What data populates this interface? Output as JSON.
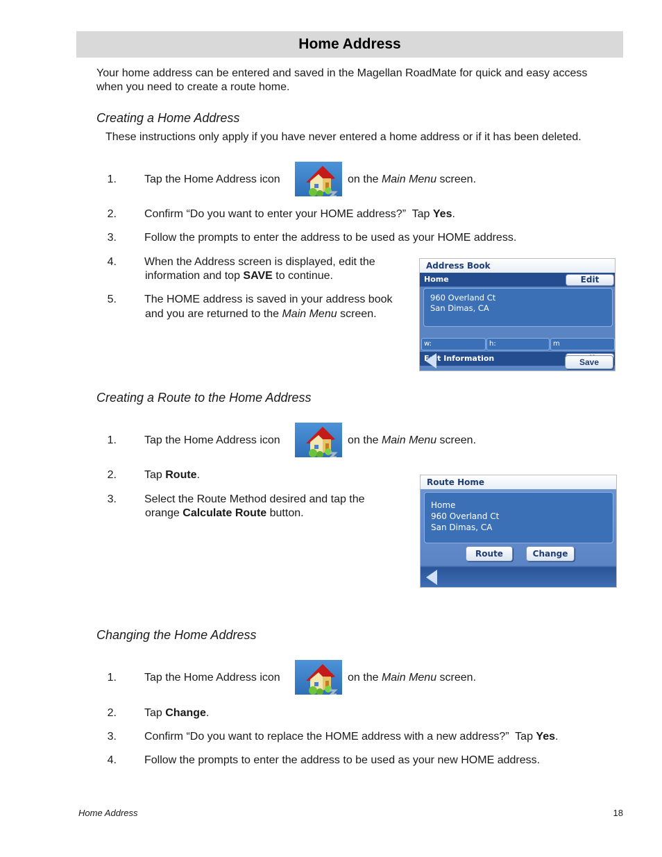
{
  "page": {
    "title": "Home Address",
    "intro": [
      "Your home address can be entered and saved in the Magellan RoadMate for quick and easy access",
      "when you need to create a route home."
    ],
    "footer": {
      "section": "Home Address",
      "page_number": "18"
    }
  },
  "sections": [
    {
      "heading": "Creating a Home Address",
      "note": "These instructions only apply if you have never entered a home address or if it has been deleted.",
      "steps": [
        {
          "num": "1.",
          "pre": "Tap the Home Address icon",
          "post_a": "on the ",
          "post_em": "Main Menu",
          "post_b": " screen.",
          "icon": "home-address-icon"
        },
        {
          "num": "2.",
          "pre": "Confirm “Do you want to enter your HOME address?”  Tap ",
          "bold": "Yes",
          "post": "."
        },
        {
          "num": "3.",
          "text": "Follow the prompts to enter the address to be used as your HOME address."
        },
        {
          "num": "4.",
          "line1": "When the Address screen is displayed, edit the",
          "line2_pre": "information and top ",
          "bold": "SAVE",
          "line2_post": " to continue."
        },
        {
          "num": "5.",
          "line1": "The HOME address is saved in your address book",
          "line2_pre": "and you are returned to the ",
          "em": "Main Menu",
          "line2_post": " screen."
        }
      ],
      "screen": {
        "title": "Address Book",
        "row_label": "Home",
        "edit_label": "Edit",
        "address": [
          "960 Overland Ct",
          "San Dimas, CA"
        ],
        "fields": [
          "w:",
          "h:",
          "m"
        ],
        "edit_info_label": "Edit Information",
        "edit2_label": "Edit",
        "save_label": "Save",
        "back_icon": "back-arrow-icon"
      }
    },
    {
      "heading": "Creating a Route to the Home Address",
      "steps": [
        {
          "num": "1.",
          "pre": "Tap the Home Address icon",
          "post_a": "on the ",
          "post_em": "Main Menu",
          "post_b": " screen.",
          "icon": "home-address-icon"
        },
        {
          "num": "2.",
          "pre": "Tap ",
          "bold": "Route",
          "post": "."
        },
        {
          "num": "3.",
          "line1": "Select the Route Method desired and tap the",
          "line2_pre": "orange ",
          "bold": "Calculate Route",
          "line2_post": " button."
        }
      ],
      "screen": {
        "title": "Route Home",
        "address": [
          "Home",
          "960 Overland Ct",
          "San Dimas, CA"
        ],
        "route_label": "Route",
        "change_label": "Change",
        "back_icon": "back-arrow-icon"
      }
    },
    {
      "heading": "Changing the Home Address",
      "steps": [
        {
          "num": "1.",
          "pre": "Tap the Home Address icon",
          "post_a": "on the ",
          "post_em": "Main Menu",
          "post_b": " screen.",
          "icon": "home-address-icon"
        },
        {
          "num": "2.",
          "pre": "Tap ",
          "bold": "Change",
          "post": "."
        },
        {
          "num": "3.",
          "pre": "Confirm “Do you want to replace the HOME address with a new address?”  Tap ",
          "bold": "Yes",
          "post": "."
        },
        {
          "num": "4.",
          "text": "Follow the prompts to enter the address to be used as your new HOME address."
        }
      ]
    }
  ]
}
